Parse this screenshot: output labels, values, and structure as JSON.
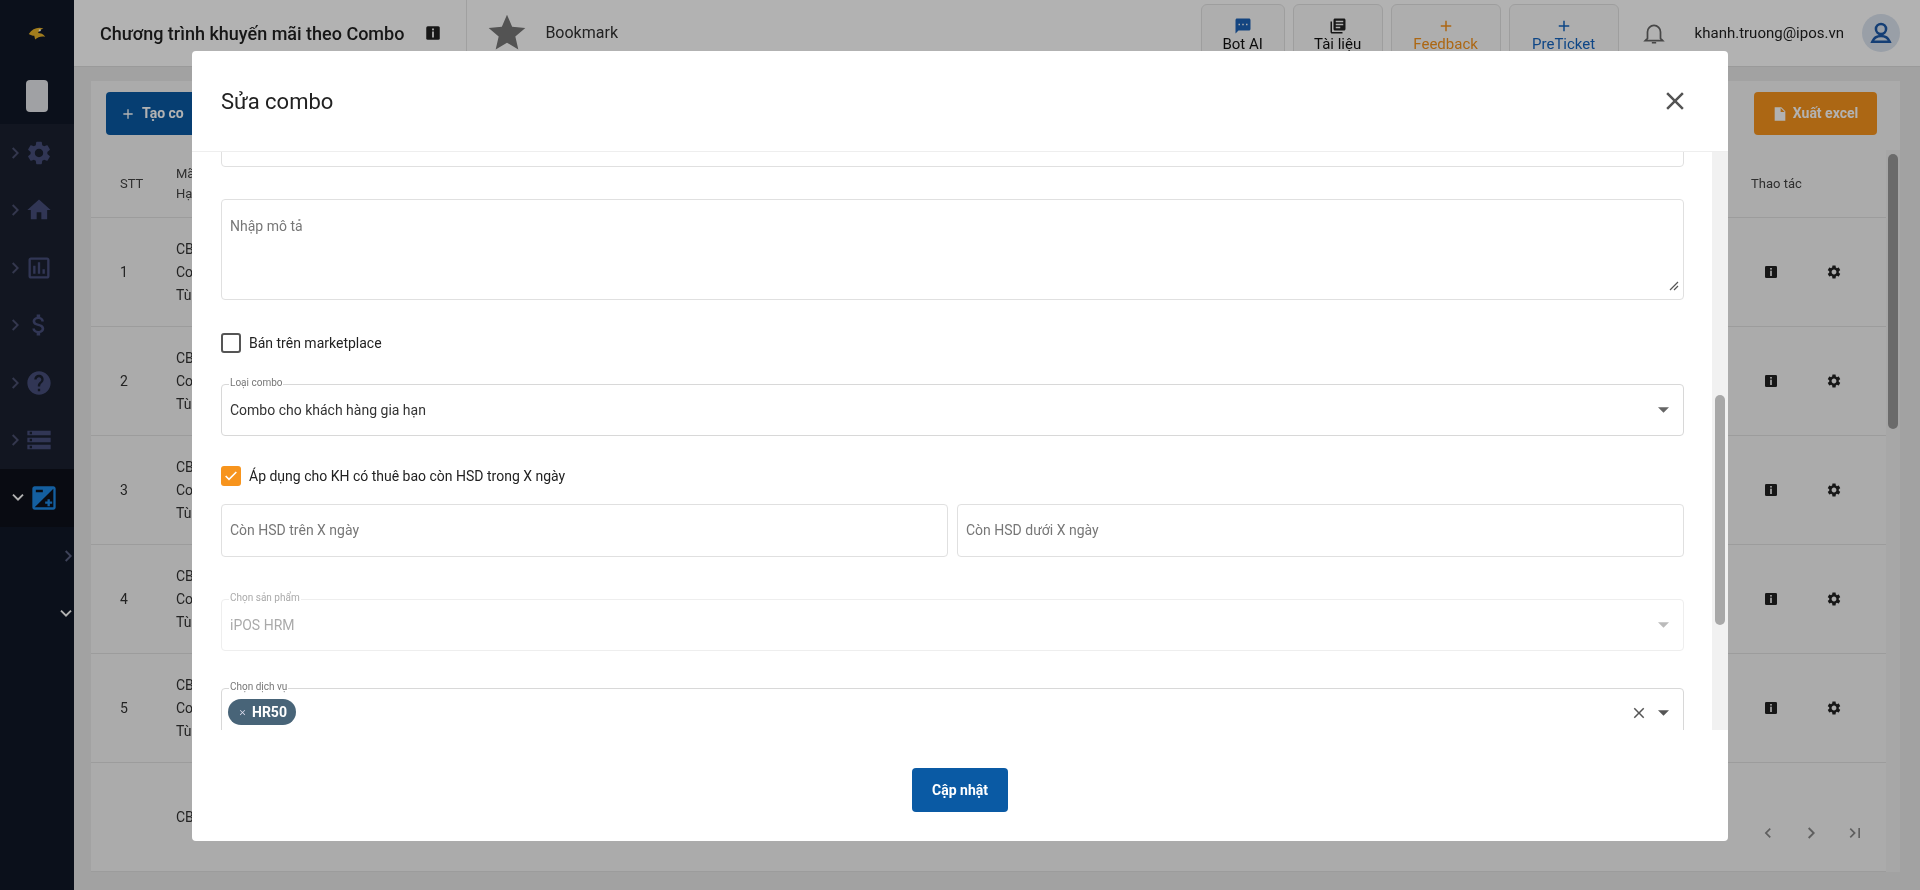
{
  "sidebar": {
    "items": [
      {
        "expanded": false,
        "selected": false
      },
      {
        "expanded": false,
        "selected": false
      },
      {
        "expanded": false,
        "selected": false
      },
      {
        "expanded": false,
        "selected": false
      },
      {
        "expanded": false,
        "selected": false
      },
      {
        "expanded": false,
        "selected": false
      },
      {
        "expanded": true,
        "selected": true,
        "children": [
          {
            "expanded": false
          },
          {
            "expanded": true
          }
        ]
      }
    ]
  },
  "header": {
    "title": "Chương trình khuyến mãi theo Combo",
    "bookmark": "Bookmark",
    "actions": [
      {
        "label": "Bot AI"
      },
      {
        "label": "Tài liệu"
      },
      {
        "label": "Feedback"
      },
      {
        "label": "PreTicket"
      }
    ],
    "user": "khanh.truong@ipos.vn"
  },
  "toolbar": {
    "create_button": "Tạo co",
    "export_button": "Xuất excel"
  },
  "table": {
    "columns": [
      {
        "lines": [
          "STT"
        ]
      },
      {
        "lines": [
          "Mã",
          "Hạ"
        ]
      },
      {
        "lines": [
          "Thao tác"
        ]
      }
    ],
    "rows": [
      {
        "stt": "1",
        "cells": [
          "CB",
          "Co",
          "Tù"
        ]
      },
      {
        "stt": "2",
        "cells": [
          "CB",
          "Co",
          "Tù"
        ]
      },
      {
        "stt": "3",
        "cells": [
          "CB",
          "Co",
          "Tù"
        ]
      },
      {
        "stt": "4",
        "cells": [
          "CB",
          "Co",
          "Tù"
        ]
      },
      {
        "stt": "5",
        "cells": [
          "CB",
          "Co",
          "Tù"
        ]
      },
      {
        "cells": [
          "CB"
        ]
      }
    ]
  },
  "modal": {
    "title": "Sửa combo",
    "fields": [
      {
        "kind": "textarea",
        "placeholder": "Nhập mô tả"
      },
      {
        "kind": "checkbox",
        "label": "Bán trên marketplace",
        "checked": false
      },
      {
        "kind": "select",
        "label": "Loại combo",
        "value": "Combo cho khách hàng gia hạn",
        "disabled": false
      },
      {
        "kind": "checkbox",
        "label": "Áp dụng cho KH có thuê bao còn HSD trong X ngày",
        "checked": true
      },
      {
        "kind": "pair",
        "fields": [
          {
            "placeholder": "Còn HSD trên X ngày"
          },
          {
            "placeholder": "Còn HSD dưới X ngày"
          }
        ]
      },
      {
        "kind": "select",
        "label": "Chọn sản phẩm",
        "value": "iPOS HRM",
        "disabled": true
      },
      {
        "kind": "multiselect",
        "label": "Chọn dịch vụ",
        "chips": [
          "HR50"
        ]
      }
    ],
    "submit": "Cập nhật"
  }
}
